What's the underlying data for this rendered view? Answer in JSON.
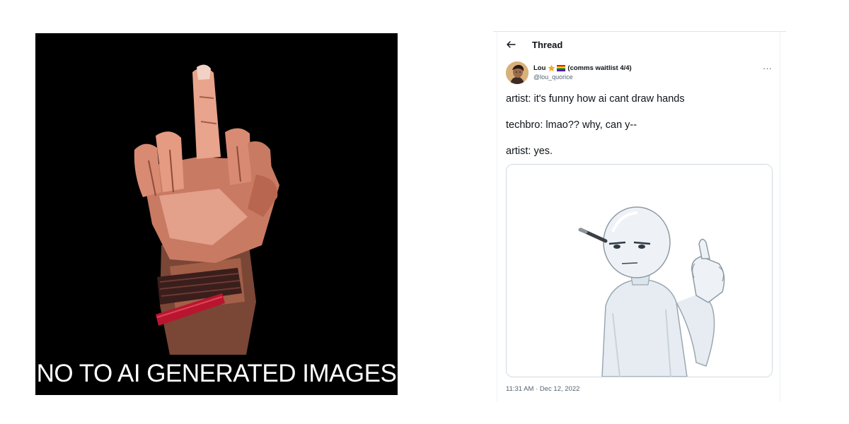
{
  "poster": {
    "caption": "NO TO AI GENERATED IMAGES",
    "background": "#000000",
    "icon": "raised-middle-finger-hand"
  },
  "thread": {
    "back_icon": "left-arrow-icon",
    "title": "Thread"
  },
  "tweet": {
    "author": {
      "name": "Lou",
      "name_suffix": "(comms waitlist 4/4)",
      "badges": [
        "star-emoji",
        "rainbow-flag-emoji"
      ],
      "handle": "@lou_quorice"
    },
    "more_icon": "more-dots-icon",
    "more_label": "···",
    "lines": [
      "artist: it's funny how ai cant draw hands",
      "techbro: lmao?? why, can y--",
      "artist: yes."
    ],
    "media": {
      "description_icon": "mannequin-middle-finger-drawing"
    },
    "timestamp": "11:31 AM · Dec 12, 2022"
  },
  "colors": {
    "text_primary": "#0f1419",
    "text_secondary": "#536471",
    "border": "#cfd9de"
  }
}
